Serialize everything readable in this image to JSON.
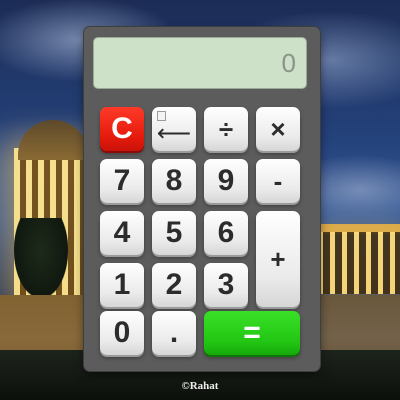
{
  "display": {
    "value": "0"
  },
  "keys": {
    "clear": "C",
    "backspace": "⟵",
    "divide": "÷",
    "multiply": "×",
    "seven": "7",
    "eight": "8",
    "nine": "9",
    "minus": "-",
    "four": "4",
    "five": "5",
    "six": "6",
    "plus": "+",
    "one": "1",
    "two": "2",
    "three": "3",
    "zero": "0",
    "decimal": ".",
    "equals": "="
  },
  "footer": {
    "credit": "©Rahat"
  },
  "colors": {
    "clear_key": "#e41a0c",
    "equals_key": "#22c613",
    "display_bg": "#cde1c8",
    "body": "#5c5c5c"
  }
}
